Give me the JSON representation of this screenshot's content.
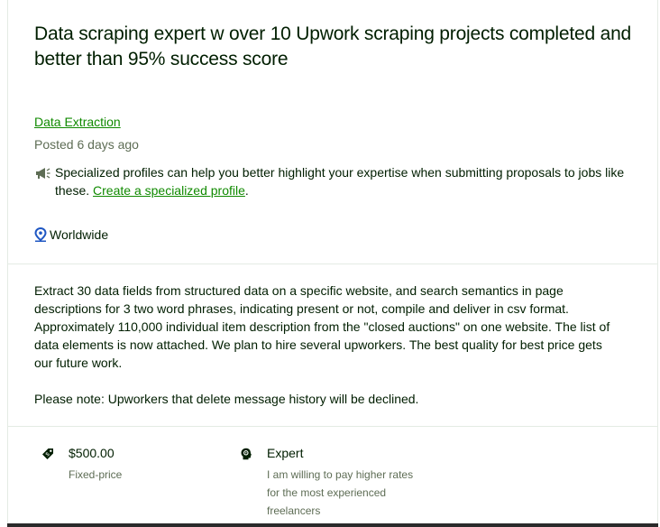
{
  "job": {
    "title": "Data scraping expert w over 10 Upwork scraping projects completed and better than 95% success score",
    "category": "Data Extraction",
    "posted": "Posted 6 days ago",
    "notice_text": "Specialized profiles can help you better highlight your expertise when submitting proposals to jobs like these. ",
    "notice_link": "Create a specialized profile",
    "notice_end": ".",
    "location": "Worldwide",
    "description": [
      "Extract 30  data fields from structured data on a specific website, and search semantics in page descriptions for 3 two word phrases, indicating present or not, compile and deliver in csv format. Approximately 110,000 individual item description from the \"closed auctions\" on one website. The list of data elements is now attached. We plan to hire several upworkers. The best quality for best price gets our future work.",
      "Please note: Upworkers that delete message history will be declined."
    ],
    "price": {
      "value": "$500.00",
      "type": "Fixed-price"
    },
    "level": {
      "value": "Expert",
      "note": "I am willing to pay higher rates for the most experienced freelancers"
    }
  },
  "icons": [
    "megaphone-icon",
    "location-pin-icon",
    "price-tag-icon",
    "expert-level-icon"
  ],
  "colors": {
    "link": "#108a00",
    "muted": "#5e6d55",
    "text": "#001e00",
    "pin": "#1f57c3"
  }
}
